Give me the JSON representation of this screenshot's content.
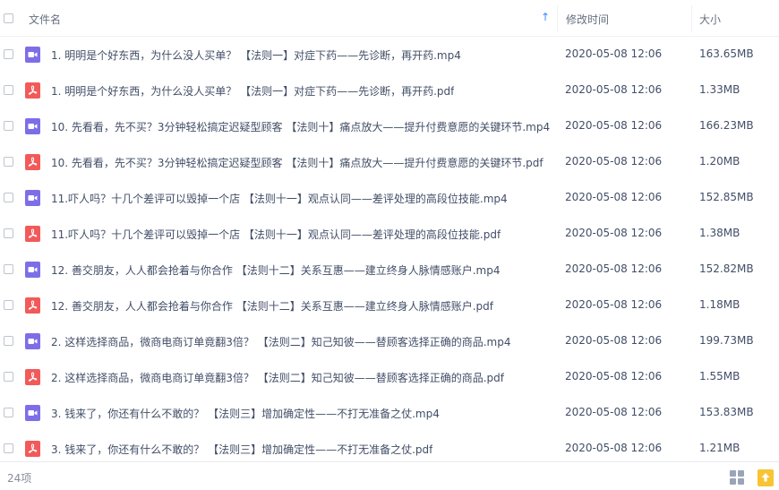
{
  "header": {
    "name_label": "文件名",
    "sort_arrow": "↑",
    "modified_label": "修改时间",
    "size_label": "大小"
  },
  "files": [
    {
      "type": "mp4",
      "name": "1. 明明是个好东西，为什么没人买单？ 【法则一】对症下药——先诊断，再开药.mp4",
      "date": "2020-05-08 12:06",
      "size": "163.65MB"
    },
    {
      "type": "pdf",
      "name": "1. 明明是个好东西，为什么没人买单？ 【法则一】对症下药——先诊断，再开药.pdf",
      "date": "2020-05-08 12:06",
      "size": "1.33MB"
    },
    {
      "type": "mp4",
      "name": "10. 先看看，先不买？3分钟轻松搞定迟疑型顾客 【法则十】痛点放大——提升付费意愿的关键环节.mp4",
      "date": "2020-05-08 12:06",
      "size": "166.23MB"
    },
    {
      "type": "pdf",
      "name": "10. 先看看，先不买？3分钟轻松搞定迟疑型顾客 【法则十】痛点放大——提升付费意愿的关键环节.pdf",
      "date": "2020-05-08 12:06",
      "size": "1.20MB"
    },
    {
      "type": "mp4",
      "name": "11.吓人吗？十几个差评可以毁掉一个店 【法则十一】观点认同——差评处理的高段位技能.mp4",
      "date": "2020-05-08 12:06",
      "size": "152.85MB"
    },
    {
      "type": "pdf",
      "name": "11.吓人吗？十几个差评可以毁掉一个店 【法则十一】观点认同——差评处理的高段位技能.pdf",
      "date": "2020-05-08 12:06",
      "size": "1.38MB"
    },
    {
      "type": "mp4",
      "name": "12. 善交朋友，人人都会抢着与你合作 【法则十二】关系互惠——建立终身人脉情感账户.mp4",
      "date": "2020-05-08 12:06",
      "size": "152.82MB"
    },
    {
      "type": "pdf",
      "name": "12. 善交朋友，人人都会抢着与你合作 【法则十二】关系互惠——建立终身人脉情感账户.pdf",
      "date": "2020-05-08 12:06",
      "size": "1.18MB"
    },
    {
      "type": "mp4",
      "name": "2. 这样选择商品，微商电商订单竟翻3倍？ 【法则二】知己知彼——替顾客选择正确的商品.mp4",
      "date": "2020-05-08 12:06",
      "size": "199.73MB"
    },
    {
      "type": "pdf",
      "name": "2. 这样选择商品，微商电商订单竟翻3倍？ 【法则二】知己知彼——替顾客选择正确的商品.pdf",
      "date": "2020-05-08 12:06",
      "size": "1.55MB"
    },
    {
      "type": "mp4",
      "name": "3. 钱来了，你还有什么不敢的？ 【法则三】增加确定性——不打无准备之仗.mp4",
      "date": "2020-05-08 12:06",
      "size": "153.83MB"
    },
    {
      "type": "pdf",
      "name": "3. 钱来了，你还有什么不敢的？ 【法则三】增加确定性——不打无准备之仗.pdf",
      "date": "2020-05-08 12:06",
      "size": "1.21MB"
    }
  ],
  "footer": {
    "count": "24项",
    "view_icon": "grid-view-icon",
    "upload_icon": "upload-icon"
  },
  "colors": {
    "video_icon": "#7d6ee8",
    "pdf_icon": "#f25a5a",
    "sort_accent": "#3b8cff",
    "upload_accent": "#f7c433"
  }
}
